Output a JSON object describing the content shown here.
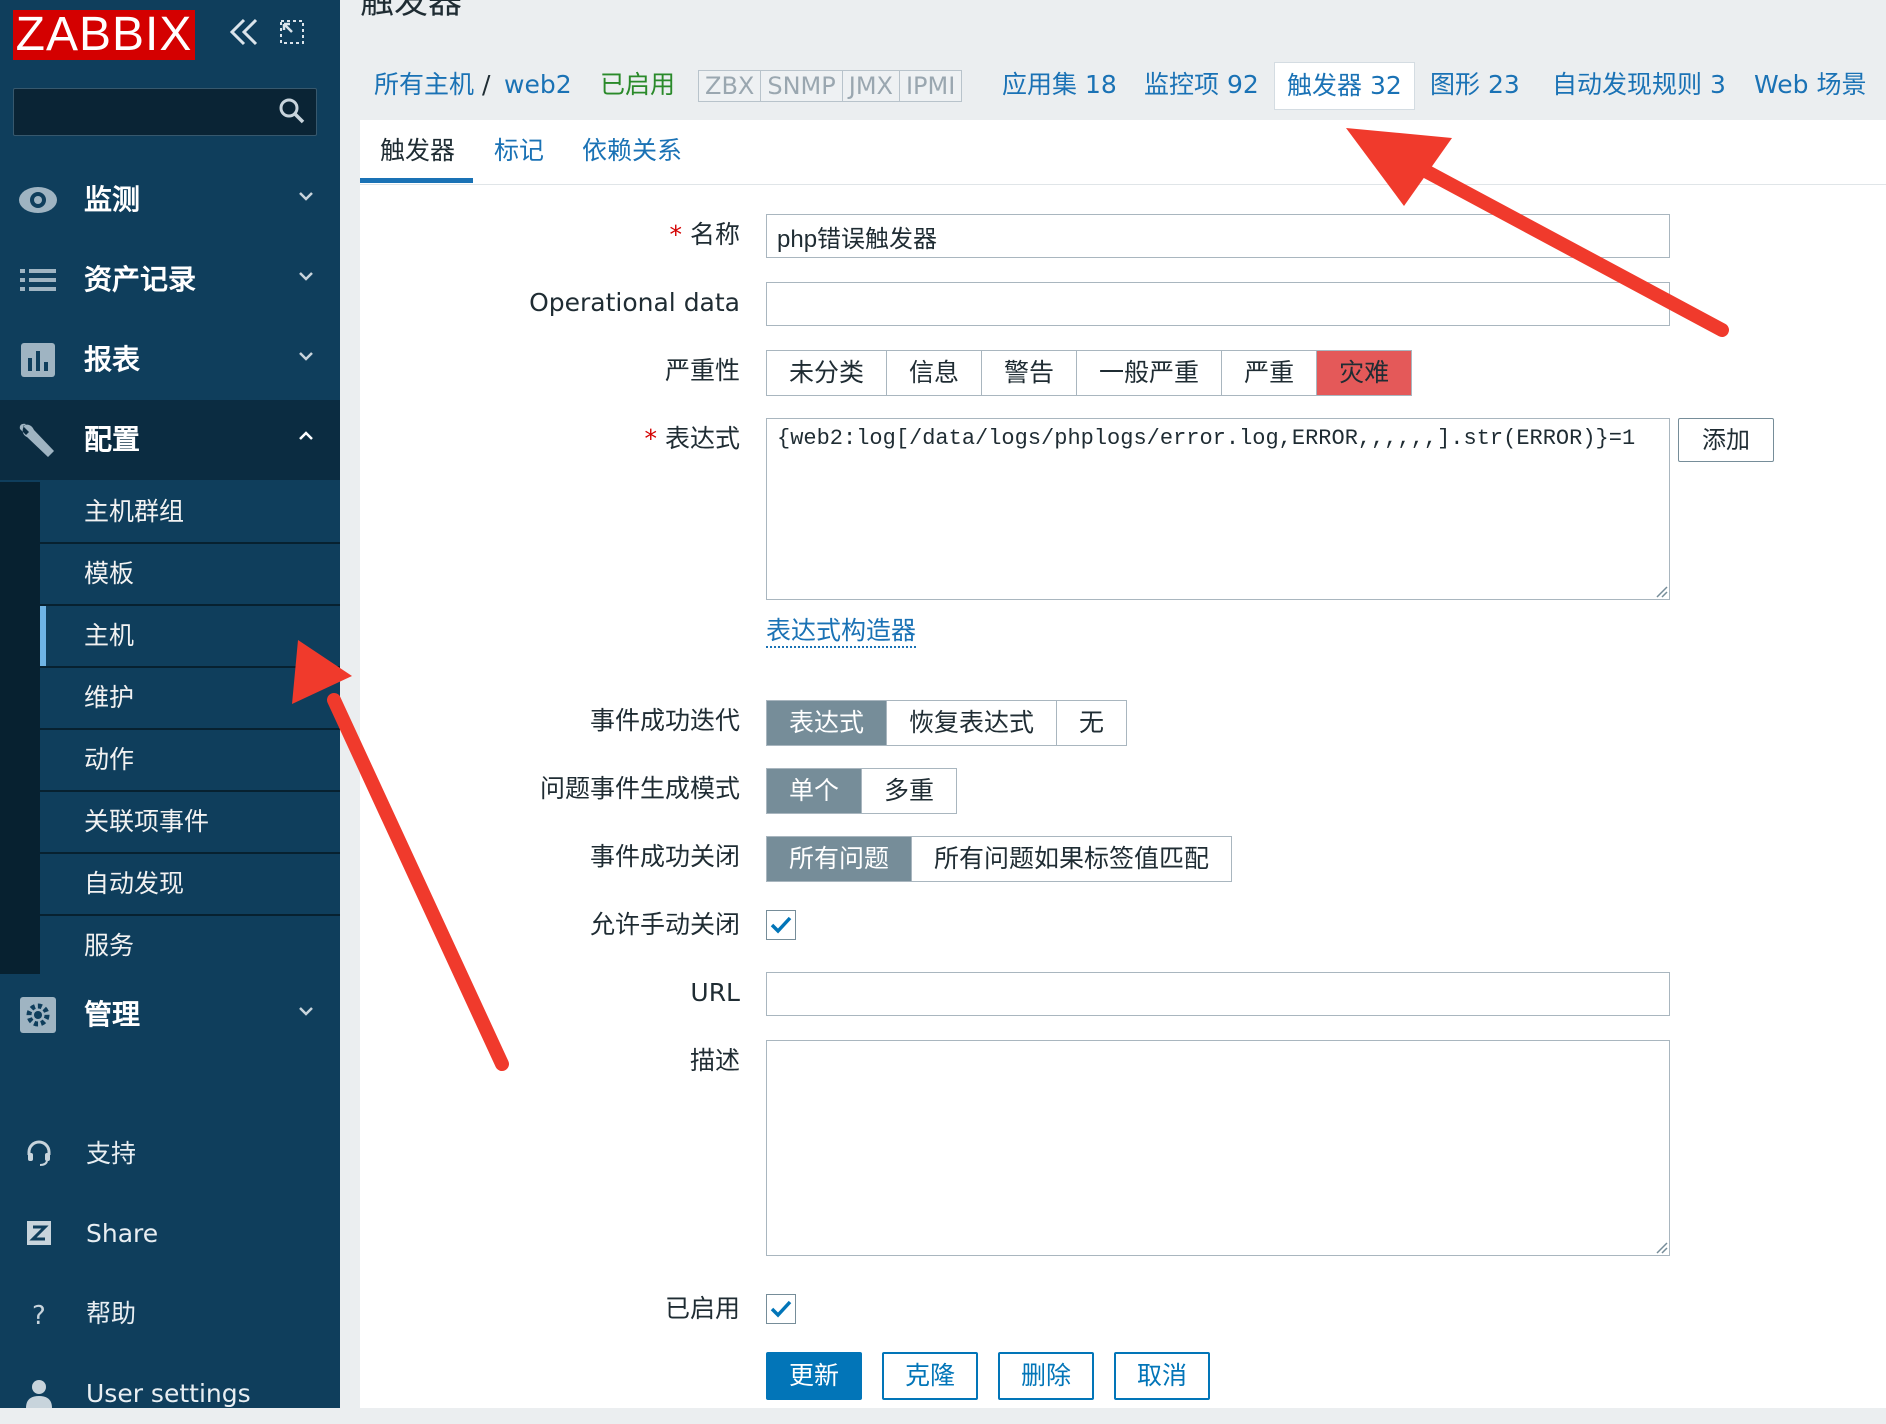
{
  "sidebar": {
    "logo": "ZABBIX",
    "collapse_icon": "double-chevron-left-icon",
    "expand_icon": "fullscreen-icon",
    "search": {
      "placeholder": "",
      "icon": "search-icon"
    },
    "menu": [
      {
        "label": "监测",
        "icon": "eye-icon"
      },
      {
        "label": "资产记录",
        "icon": "list-icon"
      },
      {
        "label": "报表",
        "icon": "bar-chart-icon"
      },
      {
        "label": "配置",
        "icon": "wrench-icon"
      }
    ],
    "config_submenu": [
      "主机群组",
      "模板",
      "主机",
      "维护",
      "动作",
      "关联项事件",
      "自动发现",
      "服务"
    ],
    "selected_submenu": "主机",
    "admin": {
      "label": "管理",
      "icon": "gear-icon"
    },
    "footer": [
      {
        "label": "支持",
        "icon": "headset-icon"
      },
      {
        "label": "Share",
        "icon": "share-z-icon"
      },
      {
        "label": "帮助",
        "icon": "help-icon"
      },
      {
        "label": "User settings",
        "icon": "user-icon"
      }
    ]
  },
  "page": {
    "title": "触发器",
    "breadcrumb": {
      "all_hosts": "所有主机",
      "sep": "/",
      "host": "web2",
      "status": "已启用",
      "protocols": [
        "ZBX",
        "SNMP",
        "JMX",
        "IPMI"
      ],
      "tabs": [
        {
          "label": "应用集 18"
        },
        {
          "label": "监控项 92"
        },
        {
          "label": "触发器 32"
        },
        {
          "label": "图形 23"
        },
        {
          "label": "自动发现规则 3"
        },
        {
          "label": "Web 场景"
        }
      ]
    },
    "subtabs": [
      "触发器",
      "标记",
      "依赖关系"
    ]
  },
  "form": {
    "name_label": "名称",
    "name_value": "php错误触发器",
    "opdata_label": "Operational data",
    "opdata_value": "",
    "severity_label": "严重性",
    "severity_options": [
      "未分类",
      "信息",
      "警告",
      "一般严重",
      "严重",
      "灾难"
    ],
    "severity_selected": "灾难",
    "expression_label": "表达式",
    "expression_value": "{web2:log[/data/logs/phplogs/error.log,ERROR,,,,,,].str(ERROR)}=1",
    "add_button": "添加",
    "expression_builder": "表达式构造器",
    "ok_event_label": "事件成功迭代",
    "ok_event_options": [
      "表达式",
      "恢复表达式",
      "无"
    ],
    "ok_event_selected": "表达式",
    "problem_mode_label": "问题事件生成模式",
    "problem_mode_options": [
      "单个",
      "多重"
    ],
    "problem_mode_selected": "单个",
    "ok_close_label": "事件成功关闭",
    "ok_close_options": [
      "所有问题",
      "所有问题如果标签值匹配"
    ],
    "ok_close_selected": "所有问题",
    "manual_close_label": "允许手动关闭",
    "manual_close_checked": true,
    "url_label": "URL",
    "url_value": "",
    "description_label": "描述",
    "description_value": "",
    "enabled_label": "已启用",
    "enabled_checked": true,
    "buttons": {
      "update": "更新",
      "clone": "克隆",
      "delete": "删除",
      "cancel": "取消"
    }
  },
  "colors": {
    "sidebar_bg": "#0f3e5c",
    "accent_blue": "#0275b8",
    "disaster_red": "#e45959",
    "annotation_arrow": "#f03a2c"
  }
}
